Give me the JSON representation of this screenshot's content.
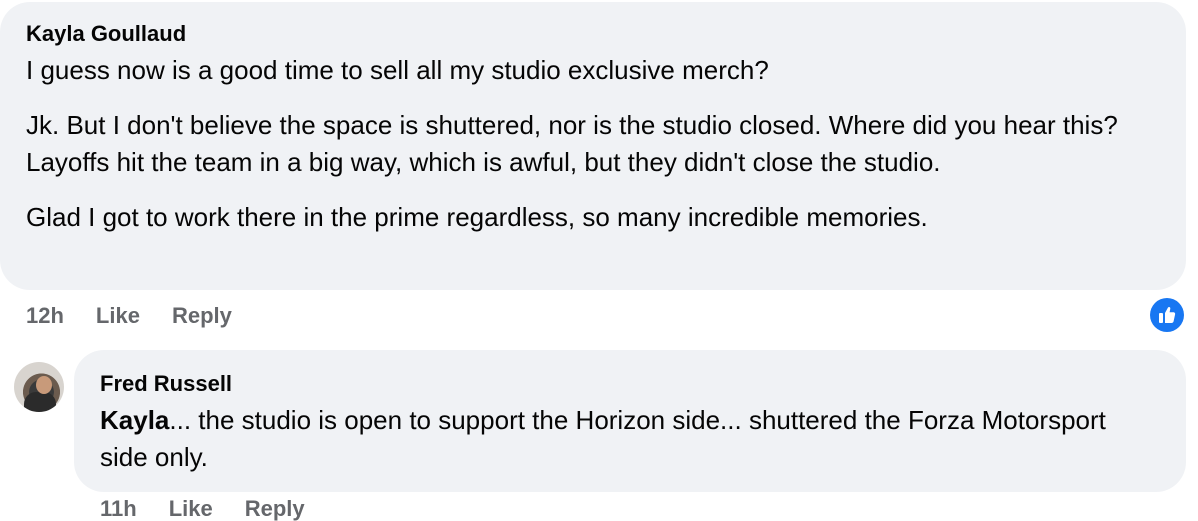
{
  "comments": [
    {
      "author": "Kayla Goullaud",
      "paragraphs": [
        "I guess now is a good time to sell all my studio exclusive merch?",
        "Jk. But I don't believe the space is shuttered, nor is the studio closed. Where did you hear this? Layoffs hit the team in a big way, which is awful, but they didn't close the studio.",
        "Glad I got to work there in the prime regardless, so many incredible memories."
      ],
      "time": "12h",
      "like_label": "Like",
      "reply_label": "Reply",
      "reaction_icon": "like-reaction-icon"
    },
    {
      "author": "Fred Russell",
      "mention": "Kayla",
      "text": "... the studio is open to support the Horizon side... shuttered the Forza Motorsport side only.",
      "time": "11h",
      "like_label": "Like",
      "reply_label": "Reply"
    }
  ],
  "colors": {
    "bubble": "#f0f2f5",
    "meta": "#65676b",
    "like_blue": "#1877f2"
  }
}
